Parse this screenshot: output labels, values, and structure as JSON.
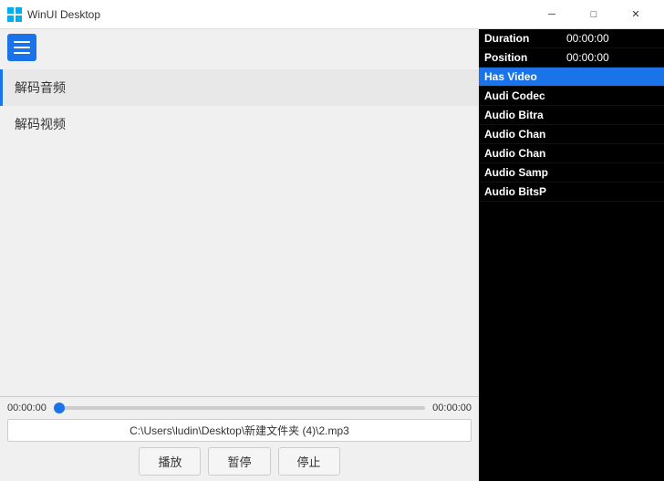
{
  "titleBar": {
    "icon": "WinUI",
    "title": "WinUI Desktop",
    "minimizeLabel": "─",
    "maximizeLabel": "□",
    "closeLabel": "✕"
  },
  "toolbar": {
    "menuAriaLabel": "Menu"
  },
  "nav": {
    "items": [
      {
        "label": "解码音频",
        "active": true
      },
      {
        "label": "解码视频",
        "active": false
      }
    ]
  },
  "progressBar": {
    "currentTime": "00:00:00",
    "endTime": "00:00:00",
    "fillPercent": 0
  },
  "filePath": "C:\\Users\\ludin\\Desktop\\新建文件夹 (4)\\2.mp3",
  "controls": {
    "play": "播放",
    "pause": "暂停",
    "stop": "停止"
  },
  "infoPanel": {
    "rows": [
      {
        "label": "Duration",
        "value": "00:00:00",
        "highlighted": false
      },
      {
        "label": "Position",
        "value": "00:00:00",
        "highlighted": false
      },
      {
        "label": "Has Video",
        "value": "",
        "highlighted": true
      },
      {
        "label": "Audi Codec",
        "value": "",
        "highlighted": false
      },
      {
        "label": "Audio Bitra",
        "value": "",
        "highlighted": false
      },
      {
        "label": "Audio Chan",
        "value": "",
        "highlighted": false
      },
      {
        "label": "Audio Chan",
        "value": "",
        "highlighted": false
      },
      {
        "label": "Audio Samp",
        "value": "",
        "highlighted": false
      },
      {
        "label": "Audio BitsP",
        "value": "",
        "highlighted": false
      }
    ]
  }
}
